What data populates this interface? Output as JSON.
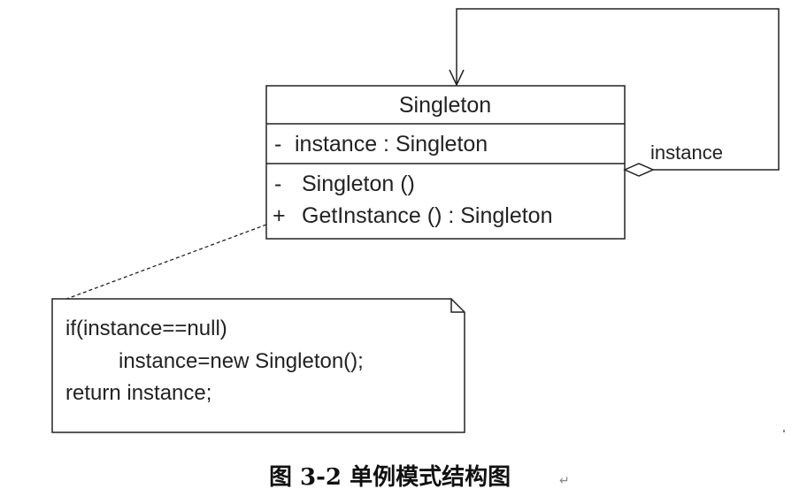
{
  "class_box": {
    "name": "Singleton",
    "attributes": [
      {
        "visibility": "-",
        "text": "instance  : Singleton"
      }
    ],
    "operations": [
      {
        "visibility": "-",
        "text": "Singleton ()"
      },
      {
        "visibility": "+",
        "text": "GetInstance () : Singleton"
      }
    ]
  },
  "association": {
    "label": "instance",
    "kind": "aggregation-self"
  },
  "note": {
    "lines": [
      "if(instance==null)",
      "instance=new Singleton();",
      "return instance;"
    ]
  },
  "caption": {
    "text": "图 3-2  单例模式结构图",
    "mark": "↵"
  },
  "colors": {
    "line": "#222222",
    "background": "#ffffff"
  }
}
